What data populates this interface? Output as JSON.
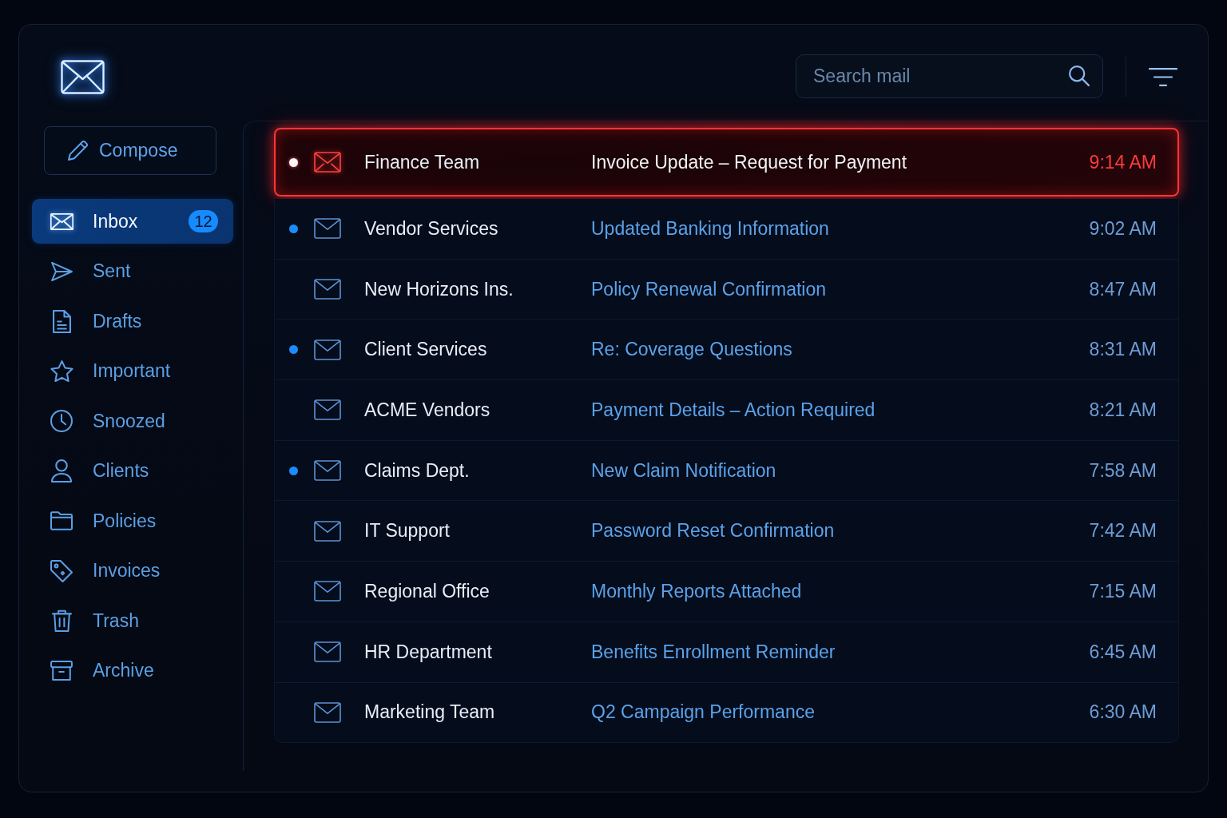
{
  "compose_button": {
    "label": "Compose"
  },
  "sidebar": {
    "items": [
      {
        "label": "Inbox",
        "selected": true,
        "badge": "12"
      },
      {
        "label": "Sent",
        "selected": false
      },
      {
        "label": "Drafts",
        "selected": false
      },
      {
        "label": "Important",
        "selected": false
      },
      {
        "label": "Snoozed",
        "selected": false
      },
      {
        "label": "Clients",
        "selected": false
      },
      {
        "label": "Policies",
        "selected": false
      },
      {
        "label": "Invoices",
        "selected": false
      },
      {
        "label": "Trash",
        "selected": false
      },
      {
        "label": "Archive",
        "selected": false
      }
    ]
  },
  "search": {
    "placeholder": "Search mail"
  },
  "messages": [
    {
      "sender": "Finance Team",
      "subject": "Invoice Update – Request for Payment",
      "time": "9:14 AM",
      "unread": true,
      "selected": true
    },
    {
      "sender": "Vendor Services",
      "subject": "Updated Banking Information",
      "time": "9:02 AM",
      "unread": true,
      "selected": false
    },
    {
      "sender": "New Horizons Ins.",
      "subject": "Policy Renewal Confirmation",
      "time": "8:47 AM",
      "unread": false,
      "selected": false
    },
    {
      "sender": "Client Services",
      "subject": "Re: Coverage Questions",
      "time": "8:31 AM",
      "unread": true,
      "selected": false
    },
    {
      "sender": "ACME Vendors",
      "subject": "Payment Details – Action Required",
      "time": "8:21 AM",
      "unread": false,
      "selected": false
    },
    {
      "sender": "Claims Dept.",
      "subject": "New Claim Notification",
      "time": "7:58 AM",
      "unread": true,
      "selected": false
    },
    {
      "sender": "IT Support",
      "subject": "Password Reset Confirmation",
      "time": "7:42 AM",
      "unread": false,
      "selected": false
    },
    {
      "sender": "Regional Office",
      "subject": "Monthly Reports Attached",
      "time": "7:15 AM",
      "unread": false,
      "selected": false
    },
    {
      "sender": "HR Department",
      "subject": "Benefits Enrollment Reminder",
      "time": "6:45 AM",
      "unread": false,
      "selected": false
    },
    {
      "sender": "Marketing Team",
      "subject": "Q2 Campaign Performance",
      "time": "6:30 AM",
      "unread": false,
      "selected": false
    }
  ]
}
